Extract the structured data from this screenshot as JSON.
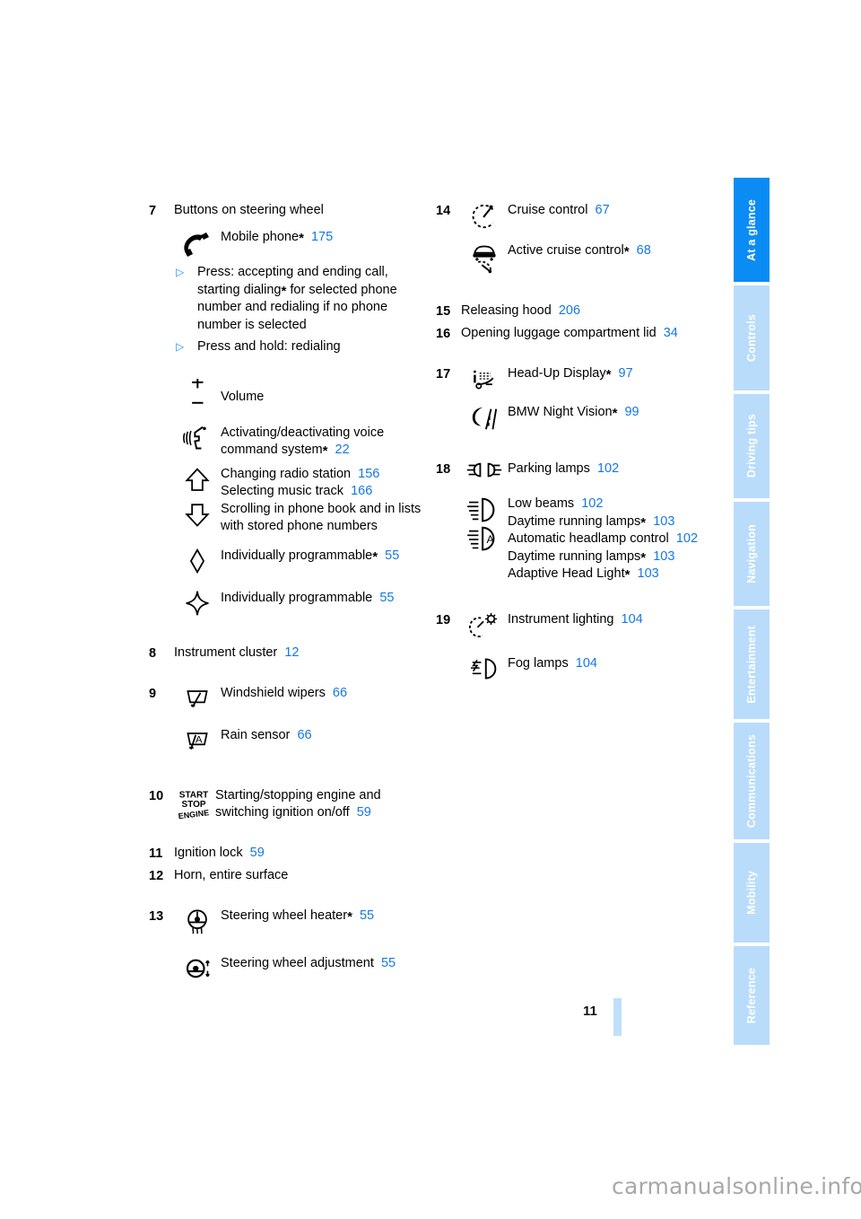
{
  "page": {
    "folio": "11",
    "watermark": "carmanualsonline.info"
  },
  "colors": {
    "accent": "#0b8cf5",
    "tab_inactive": "#b9dcfb",
    "page_ref": "#1477e6",
    "bullet": "#1f8fff"
  },
  "tabs": [
    {
      "label": "At a glance",
      "active": true
    },
    {
      "label": "Controls",
      "active": false
    },
    {
      "label": "Driving tips",
      "active": false
    },
    {
      "label": "Navigation",
      "active": false
    },
    {
      "label": "Entertainment",
      "active": false
    },
    {
      "label": "Communications",
      "active": false
    },
    {
      "label": "Mobility",
      "active": false
    },
    {
      "label": "Reference",
      "active": false
    }
  ],
  "left_column": {
    "item7": {
      "num": "7",
      "title": "Buttons on steering wheel",
      "mobile_phone": {
        "label": "Mobile phone",
        "asterisk": "*",
        "page": "175"
      },
      "bullet1": "Press: accepting and ending call, starting dialing",
      "bullet1_asterisk": "*",
      "bullet1_cont": " for selected phone number and redialing if no phone number is selected",
      "bullet2": "Press and hold: redialing",
      "volume": "Volume",
      "voice": {
        "label": "Activating/deactivating voice command system",
        "asterisk": "*",
        "page": "22"
      },
      "radio": {
        "label": "Changing radio station",
        "page": "156"
      },
      "track": {
        "label": "Selecting music track",
        "page": "166"
      },
      "scroll": "Scrolling in phone book and in lists with stored phone numbers",
      "prog_star": {
        "label": "Individually programmable",
        "asterisk": "*",
        "page": "55"
      },
      "prog": {
        "label": "Individually programmable",
        "page": "55"
      }
    },
    "item8": {
      "num": "8",
      "label": "Instrument cluster",
      "page": "12"
    },
    "item9": {
      "num": "9",
      "wipers": {
        "label": "Windshield wipers",
        "page": "66"
      },
      "rain": {
        "label": "Rain sensor",
        "page": "66"
      }
    },
    "item10": {
      "num": "10",
      "icon_line1": "START",
      "icon_line2": "STOP",
      "icon_line3": "ENGINE",
      "label": "Starting/stopping engine and switching ignition on/off",
      "page": "59"
    },
    "item11": {
      "num": "11",
      "label": "Ignition lock",
      "page": "59"
    },
    "item12": {
      "num": "12",
      "label": "Horn, entire surface"
    },
    "item13": {
      "num": "13",
      "heater": {
        "label": "Steering wheel heater",
        "asterisk": "*",
        "page": "55"
      },
      "adjust": {
        "label": "Steering wheel adjustment",
        "page": "55"
      }
    }
  },
  "right_column": {
    "item14": {
      "num": "14",
      "cruise": {
        "label": "Cruise control",
        "page": "67"
      },
      "active_cruise": {
        "label": "Active cruise control",
        "asterisk": "*",
        "page": "68"
      }
    },
    "item15": {
      "num": "15",
      "label": "Releasing hood",
      "page": "206"
    },
    "item16": {
      "num": "16",
      "label": "Opening luggage compartment lid",
      "page": "34"
    },
    "item17": {
      "num": "17",
      "hud": {
        "label": "Head-Up Display",
        "asterisk": "*",
        "page": "97"
      },
      "night": {
        "label": "BMW Night Vision",
        "asterisk": "*",
        "page": "99"
      }
    },
    "item18": {
      "num": "18",
      "parking": {
        "label": "Parking lamps",
        "page": "102"
      },
      "low_beams": {
        "label": "Low beams",
        "page": "102"
      },
      "drl1": {
        "label": "Daytime running lamps",
        "asterisk": "*",
        "page": "103"
      },
      "auto_head": {
        "label": "Automatic headlamp control",
        "page": "102"
      },
      "drl2": {
        "label": "Daytime running lamps",
        "asterisk": "*",
        "page": "103"
      },
      "adaptive": {
        "label": "Adaptive Head Light",
        "asterisk": "*",
        "page": "103"
      }
    },
    "item19": {
      "num": "19",
      "instrument": {
        "label": "Instrument lighting",
        "page": "104"
      },
      "fog": {
        "label": "Fog lamps",
        "page": "104"
      }
    }
  }
}
